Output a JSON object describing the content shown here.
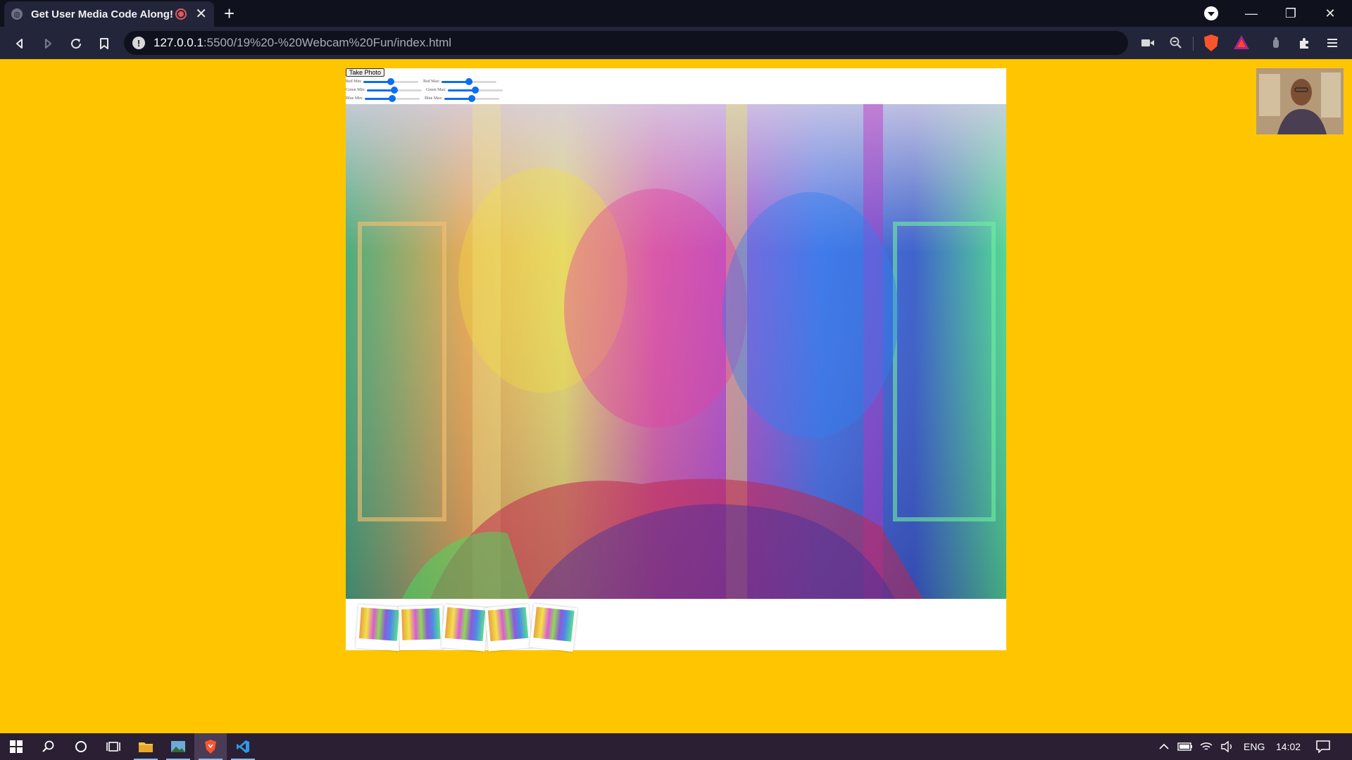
{
  "browser": {
    "tab_title": "Get User Media Code Along!",
    "tab_close": "✕",
    "new_tab": "+",
    "url_host": "127.0.0.1",
    "url_path": ":5500/19%20-%20Webcam%20Fun/index.html",
    "window_controls": {
      "minimize": "—",
      "restore": "❐",
      "close": "✕"
    }
  },
  "controls": {
    "take_photo_label": "Take Photo",
    "sliders": [
      {
        "label": "Red Min:",
        "value": 0.5
      },
      {
        "label": "Red Max:",
        "value": 0.5
      },
      {
        "label": "Green Min:",
        "value": 0.5
      },
      {
        "label": "Green Max:",
        "value": 0.5
      },
      {
        "label": "Blue Min:",
        "value": 0.5
      },
      {
        "label": "Blue Max:",
        "value": 0.5
      }
    ]
  },
  "strip": {
    "photo_count": 5
  },
  "taskbar": {
    "language": "ENG",
    "time": "14:02"
  },
  "colors": {
    "page_background": "#ffc600",
    "slider_accent": "#0a6ef0",
    "browser_dark": "#0f111c",
    "taskbar": "#2a1f33"
  }
}
